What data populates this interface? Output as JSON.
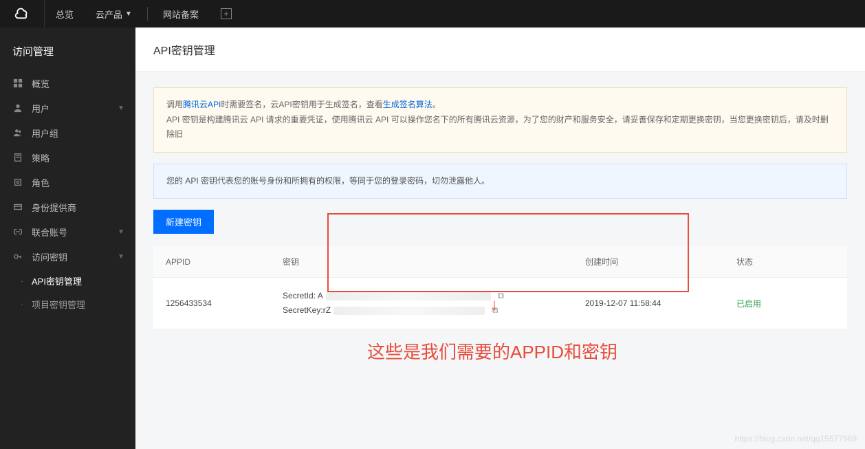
{
  "topnav": {
    "items": [
      "总览",
      "云产品",
      "网站备案"
    ]
  },
  "sidebar": {
    "title": "访问管理",
    "items": [
      {
        "label": "概览"
      },
      {
        "label": "用户",
        "expandable": true
      },
      {
        "label": "用户组"
      },
      {
        "label": "策略"
      },
      {
        "label": "角色"
      },
      {
        "label": "身份提供商"
      },
      {
        "label": "联合账号",
        "expandable": true
      },
      {
        "label": "访问密钥",
        "expandable": true
      }
    ],
    "sub_items": [
      {
        "label": "API密钥管理",
        "active": true
      },
      {
        "label": "项目密钥管理"
      }
    ]
  },
  "page": {
    "title": "API密钥管理",
    "alert1_pre": "调用",
    "alert1_link1": "腾讯云API",
    "alert1_mid": "时需要签名，云API密钥用于生成签名，查看",
    "alert1_link2": "生成签名算法",
    "alert1_post": "。",
    "alert1_line2": "API 密钥是构建腾讯云 API 请求的重要凭证，使用腾讯云 API 可以操作您名下的所有腾讯云资源，为了您的财产和服务安全，请妥善保存和定期更换密钥，当您更换密钥后，请及时删除旧",
    "alert2": "您的 API 密钥代表您的账号身份和所拥有的权限，等同于您的登录密码，切勿泄露他人。",
    "new_btn": "新建密钥",
    "table_headers": [
      "APPID",
      "密钥",
      "创建时间",
      "状态"
    ],
    "row": {
      "appid": "1256433534",
      "secret_id_label": "SecretId: A",
      "secret_key_label": "SecretKey:rZ",
      "created": "2019-12-07 11:58:44",
      "status": "已启用"
    }
  },
  "annotation": {
    "text": "这些是我们需要的APPID和密钥"
  },
  "watermark": "https://blog.csdn.net/qq15577969"
}
